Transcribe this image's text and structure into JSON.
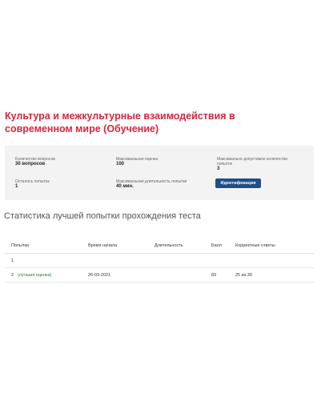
{
  "page": {
    "title": "Культура и межкультурные взаимодействия в современном мире (Обучение)"
  },
  "info": {
    "questions_label": "Количество вопросов",
    "questions_value": "30 вопросов",
    "max_score_label": "Максимальная оценка",
    "max_score_value": "100",
    "max_attempts_label": "Максимально допустимое количество попыток",
    "max_attempts_value": "3",
    "attempts_left_label": "Осталось попыток",
    "attempts_left_value": "1",
    "max_duration_label": "Максимальная длительность попытки",
    "max_duration_value": "40 мин.",
    "identification_button": "Идентификация"
  },
  "stats": {
    "heading": "Статистика лучшей попытки прохождения теста",
    "columns": [
      "Попытки",
      "Время начала",
      "Длительность",
      "Балл",
      "Корректные ответы"
    ],
    "rows": [
      {
        "attempt": "1",
        "best_label": "",
        "start": "",
        "duration": "",
        "score": "",
        "correct": ""
      },
      {
        "attempt": "2",
        "best_label": "(лучшая оценка)",
        "start": "26-03-2021",
        "duration": "",
        "score": "83",
        "correct": "25 из 30"
      }
    ]
  }
}
